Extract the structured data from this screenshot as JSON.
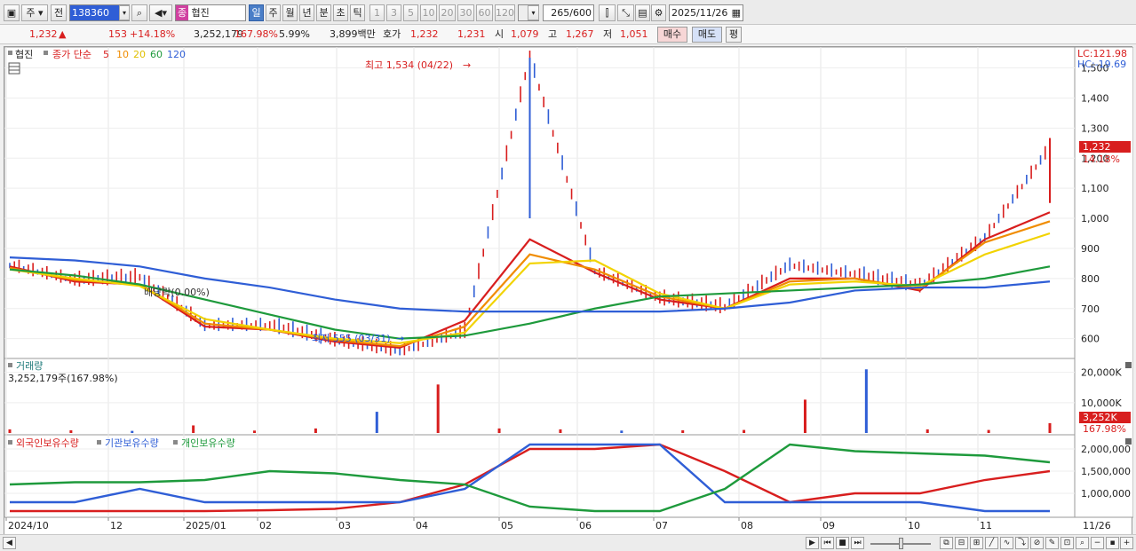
{
  "toolbar": {
    "type_select": "주",
    "prev_label": "전",
    "code": "138360",
    "stock_name": "협진",
    "stock_badge": "종",
    "periods": [
      "일",
      "주",
      "월",
      "년",
      "분",
      "초",
      "틱"
    ],
    "active_period": "일",
    "intervals": [
      "1",
      "3",
      "5",
      "10",
      "20",
      "30",
      "60",
      "120"
    ],
    "count": "265",
    "count_max": "/600",
    "date": "2025/11/26"
  },
  "quote": {
    "price": "1,232",
    "change": "153",
    "change_pct": "+14.18%",
    "volume": "3,252,179",
    "volume_ratio": "167.98%",
    "turnover": "5.99%",
    "amount": "3,899백만",
    "bid_label": "호가",
    "ask_price": "1,232",
    "bid_price": "1,231",
    "open_label": "시",
    "open": "1,079",
    "high_label": "고",
    "high": "1,267",
    "low_label": "저",
    "low": "1,051",
    "buy_label": "매수",
    "sell_label": "매도",
    "eval_label": "평"
  },
  "price_panel": {
    "stock_tag": "협진",
    "ma_label": "종가 단순",
    "ma_periods": [
      "5",
      "10",
      "20",
      "60",
      "120"
    ],
    "ma_colors": [
      "#d81e1e",
      "#f08c00",
      "#f2d300",
      "#1e9a3c",
      "#2f5ed6"
    ],
    "lc": "LC:121.98",
    "hc": "HC:-19.69",
    "max_label": "최고 1,534 (04/22)",
    "min_label": "최저 555 (03/31)",
    "dividend_label": "배당락(0.00%)",
    "current_price_tag": "1,232",
    "current_pct_tag": "14.18%",
    "y_ticks": [
      "1,500",
      "1,400",
      "1,300",
      "1,200",
      "1,100",
      "1,000",
      "900",
      "800",
      "700",
      "600"
    ]
  },
  "volume_panel": {
    "title": "거래량",
    "value": "3,252,179주(167.98%)",
    "y_ticks": [
      "20,000K",
      "10,000K"
    ],
    "tag": "3,252K",
    "tag_pct": "167.98%"
  },
  "holding_panel": {
    "legend": [
      "외국인보유수량",
      "기관보유수량",
      "개인보유수량"
    ],
    "legend_colors": [
      "#d81e1e",
      "#2f5ed6",
      "#1e9a3c"
    ],
    "y_ticks": [
      "2,000,000",
      "1,500,000",
      "1,000,000"
    ]
  },
  "x_axis": {
    "labels": [
      "2024/10",
      "12",
      "2025/01",
      "02",
      "03",
      "04",
      "05",
      "06",
      "07",
      "08",
      "09",
      "10",
      "11"
    ],
    "end_label": "11/26"
  },
  "chart_data": {
    "type": "line",
    "ohlc_summary": {
      "open": 1079,
      "high": 1267,
      "low": 1051,
      "close": 1232
    },
    "price_range": [
      540,
      1540
    ],
    "price_series": [
      {
        "x": "2024/10",
        "y": 840
      },
      {
        "x": "11",
        "y": 790
      },
      {
        "x": "12",
        "y": 800
      },
      {
        "x": "2025/01",
        "y": 640
      },
      {
        "x": "02",
        "y": 640
      },
      {
        "x": "03",
        "y": 590
      },
      {
        "x": "03/31",
        "y": 555
      },
      {
        "x": "04",
        "y": 620
      },
      {
        "x": "04/22",
        "y": 1534
      },
      {
        "x": "05",
        "y": 820
      },
      {
        "x": "06",
        "y": 730
      },
      {
        "x": "07",
        "y": 700
      },
      {
        "x": "08",
        "y": 840
      },
      {
        "x": "09",
        "y": 810
      },
      {
        "x": "10",
        "y": 770
      },
      {
        "x": "11",
        "y": 930
      },
      {
        "x": "11/26",
        "y": 1232
      }
    ],
    "moving_averages": [
      {
        "name": "5",
        "values": [
          840,
          790,
          780,
          640,
          630,
          590,
          570,
          660,
          930,
          820,
          730,
          700,
          800,
          800,
          760,
          930,
          1020
        ]
      },
      {
        "name": "10",
        "values": [
          835,
          795,
          780,
          650,
          630,
          595,
          575,
          640,
          880,
          830,
          740,
          700,
          790,
          800,
          765,
          920,
          990
        ]
      },
      {
        "name": "20",
        "values": [
          830,
          800,
          775,
          665,
          630,
          600,
          585,
          620,
          850,
          860,
          750,
          700,
          780,
          790,
          775,
          880,
          950
        ]
      },
      {
        "name": "60",
        "values": [
          830,
          810,
          780,
          730,
          680,
          630,
          600,
          610,
          650,
          700,
          740,
          750,
          760,
          770,
          780,
          800,
          840
        ]
      },
      {
        "name": "120",
        "values": [
          870,
          860,
          840,
          800,
          770,
          730,
          700,
          690,
          690,
          690,
          690,
          700,
          720,
          760,
          770,
          770,
          790
        ]
      }
    ],
    "volume_k": [
      1200,
      900,
      700,
      2500,
      800,
      1500,
      7000,
      16000,
      1500,
      1200,
      800,
      900,
      1000,
      11000,
      21000,
      1200,
      1000,
      3252
    ],
    "holdings_series": [
      {
        "name": "외국인보유수량",
        "values": [
          600000,
          600000,
          600000,
          600000,
          620000,
          650000,
          800000,
          1200000,
          2000000,
          2000000,
          2100000,
          1500000,
          800000,
          1000000,
          1000000,
          1300000,
          1500000
        ]
      },
      {
        "name": "기관보유수량",
        "values": [
          800000,
          800000,
          1100000,
          800000,
          800000,
          800000,
          800000,
          1100000,
          2100000,
          2100000,
          2100000,
          800000,
          800000,
          800000,
          800000,
          600000,
          600000
        ]
      },
      {
        "name": "개인보유수량",
        "values": [
          1200000,
          1250000,
          1250000,
          1300000,
          1500000,
          1450000,
          1300000,
          1200000,
          700000,
          600000,
          600000,
          1100000,
          2100000,
          1950000,
          1900000,
          1850000,
          1700000
        ]
      }
    ]
  }
}
